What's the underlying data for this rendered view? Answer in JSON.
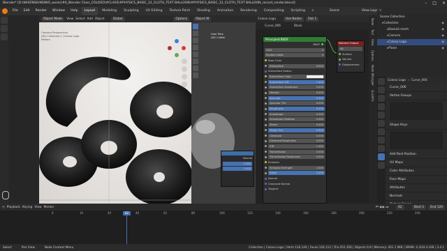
{
  "titlebar": {
    "text": "Blender* [D:\\WHIZNSIUNSIWO_works\\#0_Blender Class_COLOSO\\#CLASS\\#PHYSICS_BASIC_12_CLOTH_TEXT BALLOON\\#PHYSICS_BASIC_12_CLOTH_TEXT BALLOON_record_render.blend]"
  },
  "menu": [
    "File",
    "Edit",
    "Render",
    "Window",
    "Help"
  ],
  "workspaces": [
    "Layout",
    "Modeling",
    "Sculpting",
    "UV Editing",
    "Texture Paint",
    "Shading",
    "Animation",
    "Rendering",
    "Compositing",
    "Scripting"
  ],
  "active_workspace": "Layout",
  "scene": {
    "label": "Scene",
    "view_layer": "View Layer"
  },
  "viewport": {
    "mode": "Object Mode",
    "menus": [
      "View",
      "Select",
      "Add",
      "Object"
    ],
    "orientation": "Global",
    "options": "Options",
    "overlay_text": [
      "Camera Perspective",
      "(62) Collection | Coloso Logo",
      "Meters"
    ]
  },
  "viewport2": {
    "mode": "Object M",
    "text1": "User Pers",
    "text2": "(62) Collec",
    "panel_values": [
      "Normal",
      "1.000",
      "1.000"
    ]
  },
  "node_editor": {
    "object": "Coloso Logo",
    "use_nodes": "Use Nodes",
    "slot": "Slot 1",
    "material": "Curve_006",
    "background": "Black",
    "bsdf": {
      "title": "Principled BSDF",
      "output": "BSDF",
      "distribution": "GGX",
      "subsurface_method": "Random Walk",
      "rows": [
        {
          "label": "Base Color",
          "value": "",
          "kind": "plain",
          "socket": "#c7c729"
        },
        {
          "label": "Subsurface",
          "value": "0.000",
          "kind": "bar",
          "socket": "#a1a1a1"
        },
        {
          "label": "Subsurface Radius",
          "value": "",
          "kind": "plain",
          "socket": "#6363c7"
        },
        {
          "label": "Subsurface Color",
          "value": "",
          "kind": "color",
          "socket": "#c7c729"
        },
        {
          "label": "Subsurface IOR",
          "value": "1.400",
          "kind": "blue",
          "socket": "#a1a1a1"
        },
        {
          "label": "Subsurface Anisotropy",
          "value": "0.000",
          "kind": "bar",
          "socket": "#a1a1a1"
        },
        {
          "label": "Metallic",
          "value": "0.000",
          "kind": "bar",
          "socket": "#a1a1a1"
        },
        {
          "label": "Specular",
          "value": "0.500",
          "kind": "blue",
          "socket": "#a1a1a1"
        },
        {
          "label": "Specular Tint",
          "value": "0.000",
          "kind": "bar",
          "socket": "#a1a1a1"
        },
        {
          "label": "Roughness",
          "value": "0.500",
          "kind": "blue",
          "socket": "#a1a1a1"
        },
        {
          "label": "Anisotropic",
          "value": "0.000",
          "kind": "bar",
          "socket": "#a1a1a1"
        },
        {
          "label": "Anisotropic Rotation",
          "value": "0.000",
          "kind": "bar",
          "socket": "#a1a1a1"
        },
        {
          "label": "Sheen",
          "value": "0.000",
          "kind": "bar",
          "socket": "#a1a1a1"
        },
        {
          "label": "Sheen Tint",
          "value": "0.500",
          "kind": "blue",
          "socket": "#a1a1a1"
        },
        {
          "label": "Clearcoat",
          "value": "0.000",
          "kind": "bar",
          "socket": "#a1a1a1"
        },
        {
          "label": "Clearcoat Roughness",
          "value": "0.030",
          "kind": "bar",
          "socket": "#a1a1a1"
        },
        {
          "label": "IOR",
          "value": "1.450",
          "kind": "bar",
          "socket": "#a1a1a1"
        },
        {
          "label": "Transmission",
          "value": "0.000",
          "kind": "bar",
          "socket": "#a1a1a1"
        },
        {
          "label": "Transmission Roughness",
          "value": "0.000",
          "kind": "bar",
          "socket": "#a1a1a1"
        },
        {
          "label": "Emission",
          "value": "",
          "kind": "plain",
          "socket": "#c7c729"
        },
        {
          "label": "Emission Strength",
          "value": "1.000",
          "kind": "bar",
          "socket": "#a1a1a1"
        },
        {
          "label": "Alpha",
          "value": "1.000",
          "kind": "blue",
          "socket": "#a1a1a1"
        },
        {
          "label": "Normal",
          "value": "",
          "kind": "plain",
          "socket": "#6363c7"
        },
        {
          "label": "Clearcoat Normal",
          "value": "",
          "kind": "plain",
          "socket": "#6363c7"
        },
        {
          "label": "Tangent",
          "value": "",
          "kind": "plain",
          "socket": "#6363c7"
        }
      ]
    },
    "output_node": {
      "title": "Material Output",
      "target": "All",
      "sockets": [
        "Surface",
        "Volume",
        "Displacement"
      ]
    },
    "side_tabs": [
      "Node",
      "Tool",
      "View",
      "Options",
      "Node Wrangler",
      "QuickFix"
    ]
  },
  "outliner": {
    "root": "Scene Collection",
    "items": [
      {
        "name": "Collection",
        "indent": 1,
        "selected": false
      },
      {
        "name": "BaseLit.mesh",
        "indent": 2,
        "selected": false
      },
      {
        "name": "Camera",
        "indent": 2,
        "selected": false
      },
      {
        "name": "Coloso Logo",
        "indent": 2,
        "selected": true
      },
      {
        "name": "Plane",
        "indent": 2,
        "selected": false
      }
    ]
  },
  "properties": {
    "object_name": "Coloso Logo",
    "data_name": "Curve_006",
    "mesh_name": "Curve_006",
    "sections": [
      "Vertex Groups",
      "Shape Keys",
      "UV Maps",
      "Color Attributes",
      "Face Maps",
      "Attributes",
      "Normals",
      "Texture Space",
      "Remesh",
      "Geometry Data"
    ],
    "add_rest_position": "Add Rest Position"
  },
  "timeline": {
    "menus": [
      "Playback",
      "Keying",
      "View",
      "Marker"
    ],
    "current_frame": "62",
    "start_label": "Start",
    "start": "1",
    "end_label": "End",
    "end": "120",
    "ticks": [
      "0",
      "10",
      "20",
      "40",
      "62",
      "80",
      "100",
      "120",
      "140",
      "160",
      "180",
      "200",
      "220",
      "240"
    ]
  },
  "status": {
    "left1": "Select",
    "left2": "Pan View",
    "middle": "Node Context Menu",
    "stats": "Collection | Coloso Logo | Verts:126,144 | Faces:126,112 | Tris:252,356 | Objects:1/4 | Memory: 401.1 MiB | VRAM: 4.3/24.0 GiB | 3.4.1"
  }
}
